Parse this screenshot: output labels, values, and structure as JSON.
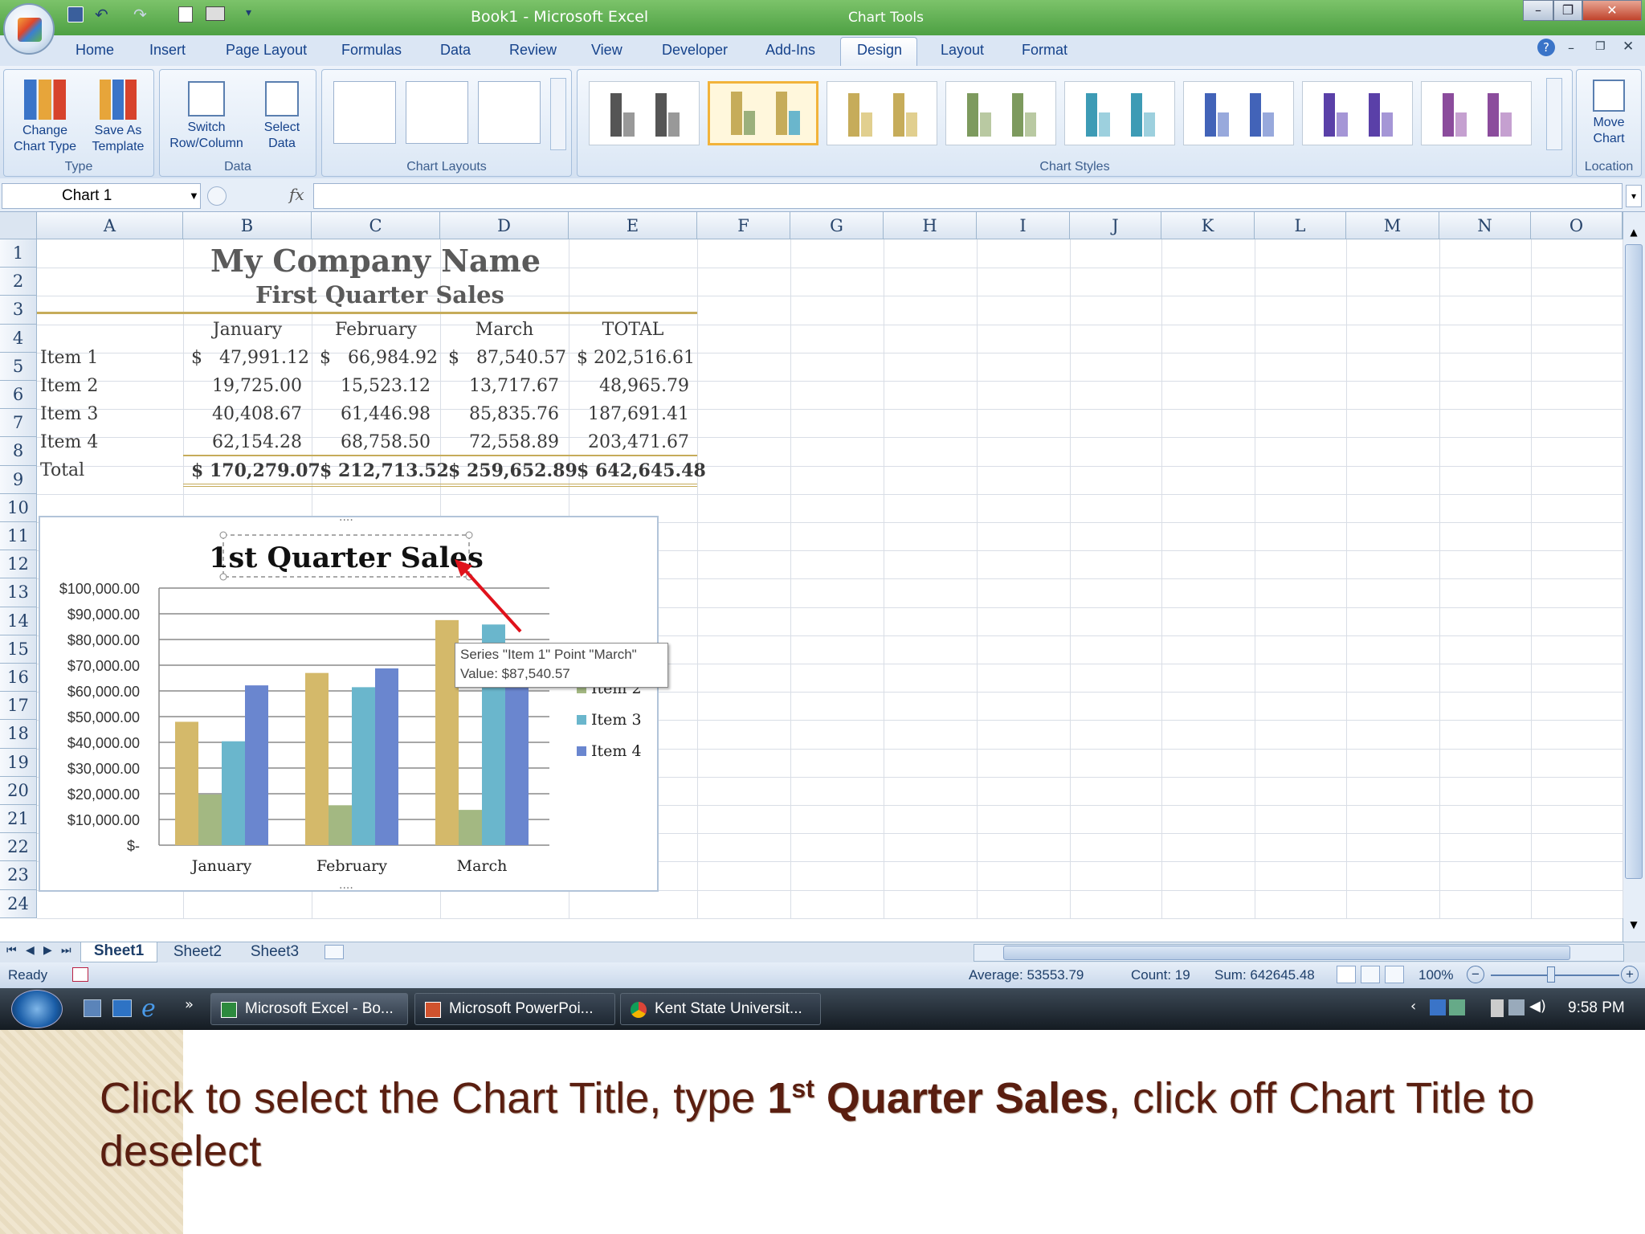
{
  "window": {
    "title": "Book1 - Microsoft Excel",
    "context_title": "Chart Tools"
  },
  "tabs": [
    "Home",
    "Insert",
    "Page Layout",
    "Formulas",
    "Data",
    "Review",
    "View",
    "Developer",
    "Add-Ins",
    "Design",
    "Layout",
    "Format"
  ],
  "active_tab": "Design",
  "ribbon": {
    "type_group": {
      "label": "Type",
      "change_chart_type": [
        "Change",
        "Chart Type"
      ],
      "save_as_template": [
        "Save As",
        "Template"
      ]
    },
    "data_group": {
      "label": "Data",
      "switch_row_column": [
        "Switch",
        "Row/Column"
      ],
      "select_data": [
        "Select",
        "Data"
      ]
    },
    "chart_layouts": {
      "label": "Chart Layouts"
    },
    "chart_styles": {
      "label": "Chart Styles"
    },
    "location_group": {
      "label": "Location",
      "move_chart": [
        "Move",
        "Chart"
      ]
    }
  },
  "name_box": "Chart 1",
  "fx_label": "fx",
  "columns": [
    "A",
    "B",
    "C",
    "D",
    "E",
    "F",
    "G",
    "H",
    "I",
    "J",
    "K",
    "L",
    "M",
    "N",
    "O"
  ],
  "rows": [
    "1",
    "2",
    "3",
    "4",
    "5",
    "6",
    "7",
    "8",
    "9",
    "10",
    "11",
    "12",
    "13",
    "14",
    "15",
    "16",
    "17",
    "18",
    "19",
    "20",
    "21",
    "22",
    "23",
    "24"
  ],
  "sheet": {
    "company": "My Company Name",
    "subtitle": "First Quarter Sales",
    "headers": [
      "January",
      "February",
      "March",
      "TOTAL"
    ],
    "items": [
      {
        "name": "Item 1",
        "jan": "$   47,991.12",
        "feb": "$   66,984.92",
        "mar": "$   87,540.57",
        "total": "$ 202,516.61"
      },
      {
        "name": "Item 2",
        "jan": "19,725.00",
        "feb": "15,523.12",
        "mar": "13,717.67",
        "total": "48,965.79"
      },
      {
        "name": "Item 3",
        "jan": "40,408.67",
        "feb": "61,446.98",
        "mar": "85,835.76",
        "total": "187,691.41"
      },
      {
        "name": "Item 4",
        "jan": "62,154.28",
        "feb": "68,758.50",
        "mar": "72,558.89",
        "total": "203,471.67"
      }
    ],
    "total_row": {
      "name": "Total",
      "jan": "$ 170,279.07",
      "feb": "$ 212,713.52",
      "mar": "$ 259,652.89",
      "total": "$ 642,645.48"
    }
  },
  "chart_data": {
    "type": "bar",
    "title": "1st Quarter Sales",
    "categories": [
      "January",
      "February",
      "March"
    ],
    "series": [
      {
        "name": "Item 1",
        "values": [
          47991.12,
          66984.92,
          87540.57
        ],
        "color": "#d4b96a"
      },
      {
        "name": "Item 2",
        "values": [
          19725.0,
          15523.12,
          13717.67
        ],
        "color": "#a3b882"
      },
      {
        "name": "Item 3",
        "values": [
          40408.67,
          61446.98,
          85835.76
        ],
        "color": "#6ab6cc"
      },
      {
        "name": "Item 4",
        "values": [
          62154.28,
          68758.5,
          72558.89
        ],
        "color": "#6a86cf"
      }
    ],
    "ylim": [
      0,
      100000
    ],
    "yticks": [
      "$100,000.00",
      "$90,000.00",
      "$80,000.00",
      "$70,000.00",
      "$60,000.00",
      "$50,000.00",
      "$40,000.00",
      "$30,000.00",
      "$20,000.00",
      "$10,000.00",
      "$-"
    ],
    "legend_visible": [
      "Item 2",
      "Item 3",
      "Item 4"
    ],
    "grid": true,
    "legend_position": "right"
  },
  "tooltip": {
    "line1": "Series \"Item 1\" Point \"March\"",
    "line2": "Value:  $87,540.57"
  },
  "sheet_tabs": [
    "Sheet1",
    "Sheet2",
    "Sheet3"
  ],
  "status": {
    "ready": "Ready",
    "average": "Average: 53553.79",
    "count": "Count: 19",
    "sum": "Sum: 642645.48",
    "zoom": "100%"
  },
  "taskbar": {
    "items": [
      "Microsoft Excel - Bo...",
      "Microsoft PowerPoi...",
      "Kent State Universit..."
    ],
    "clock": "9:58 PM"
  },
  "caption": {
    "part1": "Click to select the Chart Title, type ",
    "bold_1": "1",
    "sup": "st",
    "bold_2": " Quarter Sales",
    "part2": ", click off Chart Title to deselect"
  }
}
